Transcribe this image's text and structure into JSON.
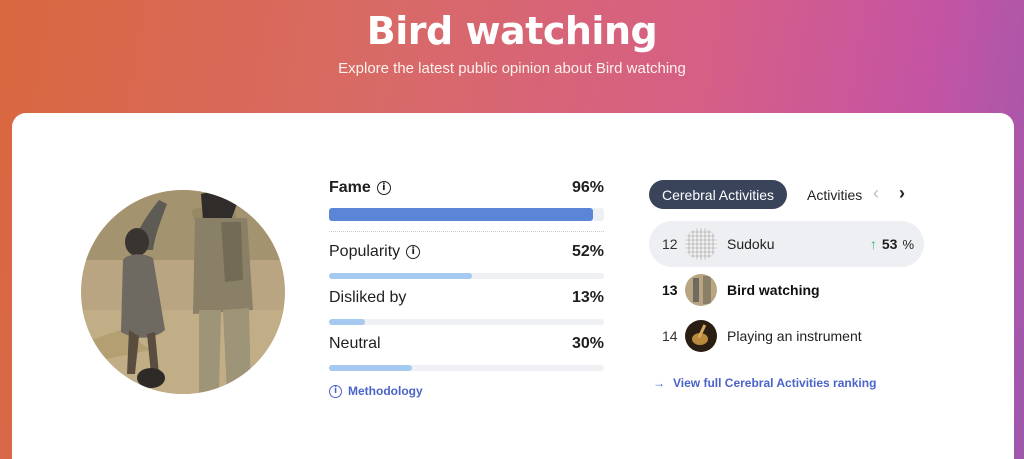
{
  "header": {
    "title": "Bird watching",
    "subtitle": "Explore the latest public opinion about Bird watching"
  },
  "metrics": [
    {
      "label": "Fame",
      "value_text": "96%",
      "value": 0.96,
      "info": true
    },
    {
      "label": "Popularity",
      "value_text": "52%",
      "value": 0.52,
      "info": true
    },
    {
      "label": "Disliked by",
      "value_text": "13%",
      "value": 0.13,
      "info": false
    },
    {
      "label": "Neutral",
      "value_text": "30%",
      "value": 0.3,
      "info": false
    }
  ],
  "methodology_label": "Methodology",
  "ranking": {
    "active_tab": "Cerebral Activities",
    "next_tab": "Activities",
    "items": [
      {
        "rank": "12",
        "name": "Sudoku",
        "trend_value": "53",
        "trend_unit": "%"
      },
      {
        "rank": "13",
        "name": "Bird watching"
      },
      {
        "rank": "14",
        "name": "Playing an instrument"
      }
    ],
    "view_link": "View full Cerebral Activities ranking"
  },
  "icons": {
    "info": "info-icon",
    "up": "arrow-up-icon",
    "chevron_left": "chevron-left-icon",
    "chevron_right": "chevron-right-icon",
    "link_arrow": "arrow-right-icon"
  },
  "colors": {
    "fame_bar": "#5b86d8",
    "other_bars": "#a5c9ef",
    "link": "#4a64c9",
    "tab_active_bg": "#39435a",
    "trend_up": "#3db385"
  }
}
